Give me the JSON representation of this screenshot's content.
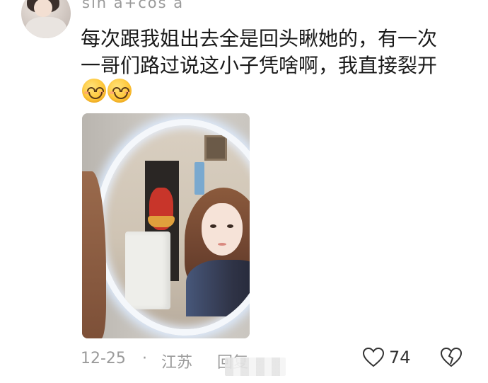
{
  "comment": {
    "username": "sin a+cos a",
    "text_lines": [
      "每次跟我姐出去全是回头瞅她的，有一次",
      "一哥们路过说这小子凭啥啊，我直接裂开"
    ],
    "emojis": [
      "smiling-face-icon",
      "smiling-face-icon"
    ],
    "date": "12-25",
    "separator": "·",
    "location": "江苏",
    "reply_label": "回复",
    "like_count": "74"
  }
}
